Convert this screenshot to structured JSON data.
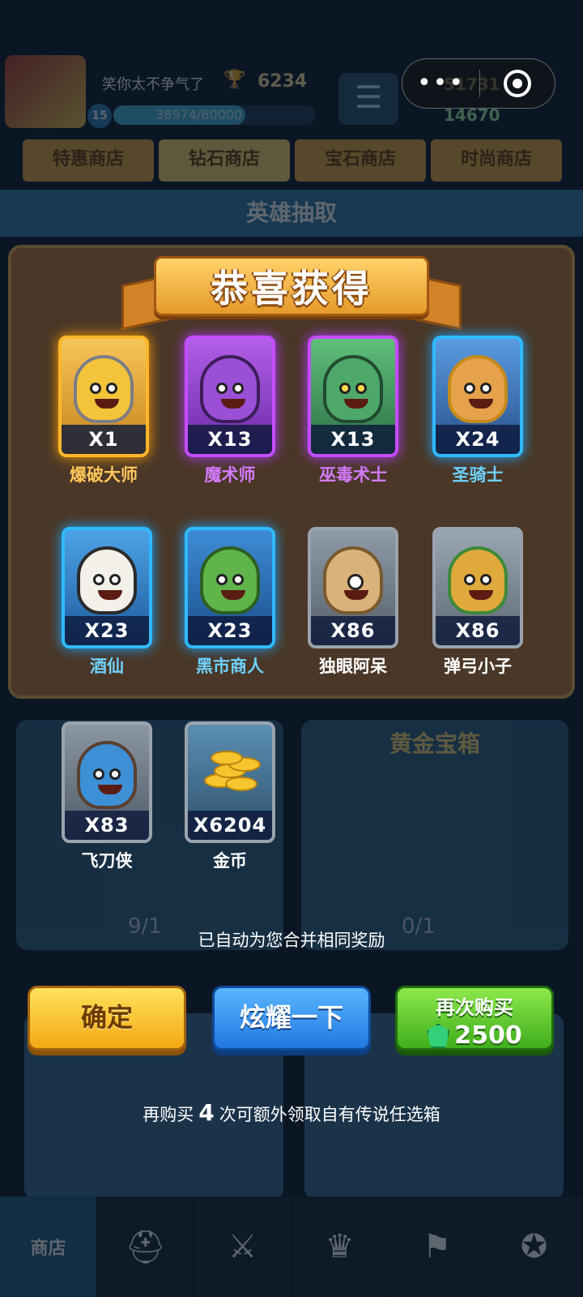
{
  "header": {
    "player_name": "笑你太不争气了",
    "trophy_icon": "trophy-icon",
    "trophies": "6234",
    "level": "15",
    "xp_text": "38974/60000",
    "xp_fraction": 0.65,
    "currency_gold": "51731",
    "currency_gem": "14670"
  },
  "capsule": {
    "more_label": "•••",
    "close_icon": "target-ring-icon"
  },
  "shop_tabs": [
    "特惠商店",
    "钻石商店",
    "宝石商店",
    "时尚商店"
  ],
  "section_title": "英雄抽取",
  "modal": {
    "title": "恭喜获得",
    "rewards": [
      {
        "name": "爆破大师",
        "qty": "X1",
        "quality": "gold"
      },
      {
        "name": "魔术师",
        "qty": "X13",
        "quality": "purple"
      },
      {
        "name": "巫毒术士",
        "qty": "X13",
        "quality": "purple"
      },
      {
        "name": "圣骑士",
        "qty": "X24",
        "quality": "blue"
      },
      {
        "name": "酒仙",
        "qty": "X23",
        "quality": "blue"
      },
      {
        "name": "黑市商人",
        "qty": "X23",
        "quality": "blue"
      },
      {
        "name": "独眼阿呆",
        "qty": "X86",
        "quality": "gray"
      },
      {
        "name": "弹弓小子",
        "qty": "X86",
        "quality": "gray"
      },
      {
        "name": "飞刀侠",
        "qty": "X83",
        "quality": "gray"
      },
      {
        "name": "金币",
        "qty": "X6204",
        "quality": "gray"
      }
    ],
    "merge_note": "已自动为您合并相同奖励",
    "buttons": {
      "confirm": "确定",
      "show_off": "炫耀一下",
      "buy_again": "再次购买",
      "buy_price": "2500"
    },
    "buy_note_prefix": "再购买",
    "buy_note_count": "4",
    "buy_note_suffix": "次可额外领取自有传说任选箱"
  },
  "background": {
    "gold_chest_title": "黄金宝箱",
    "keys_left": "9/1",
    "keys_right": "0/1"
  },
  "nav": {
    "shop_label": "商店"
  },
  "colors": {
    "gold": "#ffb72a",
    "purple": "#c44dff",
    "blue": "#2fb9ff",
    "gray": "#9aa3ad"
  }
}
